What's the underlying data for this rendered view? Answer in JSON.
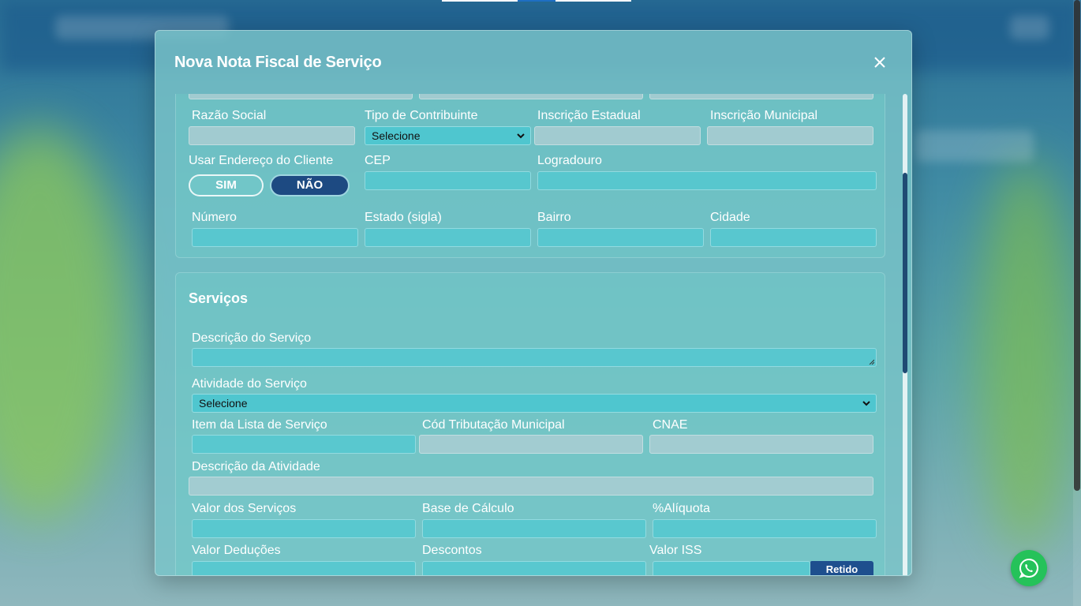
{
  "modal": {
    "title": "Nova Nota Fiscal de Serviço"
  },
  "cliente": {
    "razao_social_label": "Razão Social",
    "tipo_contribuinte_label": "Tipo de Contribuinte",
    "tipo_contribuinte_value": "Selecione",
    "inscricao_estadual_label": "Inscrição Estadual",
    "inscricao_municipal_label": "Inscrição Municipal",
    "usar_endereco_label": "Usar Endereço do Cliente",
    "sim_label": "SIM",
    "nao_label": "NÃO",
    "cep_label": "CEP",
    "logradouro_label": "Logradouro",
    "numero_label": "Número",
    "estado_label": "Estado (sigla)",
    "bairro_label": "Bairro",
    "cidade_label": "Cidade"
  },
  "servicos": {
    "title": "Serviços",
    "descricao_label": "Descrição do Serviço",
    "atividade_label": "Atividade do Serviço",
    "atividade_value": "Selecione",
    "item_lista_label": "Item da Lista de Serviço",
    "cod_tributacao_label": "Cód Tributação Municipal",
    "cnae_label": "CNAE",
    "descricao_atividade_label": "Descrição da Atividade",
    "valor_servicos_label": "Valor dos Serviços",
    "base_calculo_label": "Base de Cálculo",
    "aliquota_label": "%Alíquota",
    "valor_deducoes_label": "Valor Deduções",
    "descontos_label": "Descontos",
    "valor_iss_label": "Valor ISS",
    "retido_label": "Retido"
  },
  "icons": {
    "close": "close-icon",
    "select_chevron": "chevron-down-icon",
    "whatsapp": "whatsapp-icon"
  },
  "colors": {
    "toggle_active": "#1d4a82",
    "whatsapp": "#25c25a",
    "retido": "#1e4f8e"
  }
}
